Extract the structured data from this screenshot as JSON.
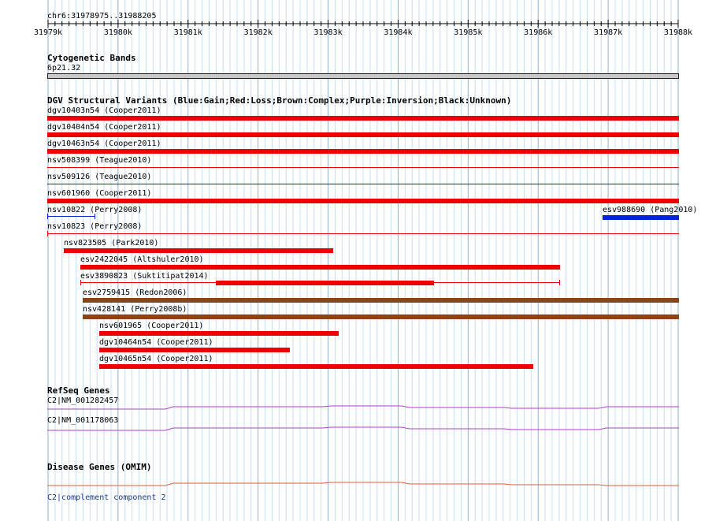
{
  "coords": "chr6:31978975..31988205",
  "ruler": {
    "ticks": [
      "31979k",
      "31980k",
      "31981k",
      "31982k",
      "31983k",
      "31984k",
      "31985k",
      "31986k",
      "31987k",
      "31988k"
    ],
    "tick_pos": [
      0,
      1,
      2,
      3,
      4,
      5,
      6,
      7,
      8,
      9
    ]
  },
  "cytoband": {
    "title": "Cytogenetic Bands",
    "band": "6p21.32"
  },
  "dgv": {
    "title": "DGV Structural Variants (Blue:Gain;Red:Loss;Brown:Complex;Purple:Inversion;Black:Unknown)",
    "colors": {
      "red": "#ee0000",
      "blue": "#0022dd",
      "brown": "#8b4513",
      "darkblue": "#1a3070"
    },
    "items": [
      {
        "label": "dgv10403n54 (Cooper2011)"
      },
      {
        "label": "dgv10404n54 (Cooper2011)"
      },
      {
        "label": "dgv10463n54 (Cooper2011)"
      },
      {
        "label": "nsv508399 (Teague2010)"
      },
      {
        "label": "nsv509126 (Teague2010)"
      },
      {
        "label": "nsv601960 (Cooper2011)"
      },
      {
        "label": "nsv10822 (Perry2008)"
      },
      {
        "label": "esv988690 (Pang2010)"
      },
      {
        "label": "nsv10823 (Perry2008)"
      },
      {
        "label": "nsv823505 (Park2010)"
      },
      {
        "label": "esv2422045 (Altshuler2010)"
      },
      {
        "label": "esv3890823 (Suktitipat2014)"
      },
      {
        "label": "esv2759415 (Redon2006)"
      },
      {
        "label": "nsv428141 (Perry2008b)"
      },
      {
        "label": "nsv601965 (Cooper2011)"
      },
      {
        "label": "dgv10464n54 (Cooper2011)"
      },
      {
        "label": "dgv10465n54 (Cooper2011)"
      }
    ]
  },
  "refseq": {
    "title": "RefSeq Genes",
    "color": "#b040c8",
    "items": [
      {
        "label": "C2|NM_001282457"
      },
      {
        "label": "C2|NM_001178063"
      }
    ]
  },
  "omim": {
    "title": "Disease Genes (OMIM)",
    "color": "#e06040",
    "items": [
      {
        "label": "C2|complement component 2"
      }
    ]
  }
}
